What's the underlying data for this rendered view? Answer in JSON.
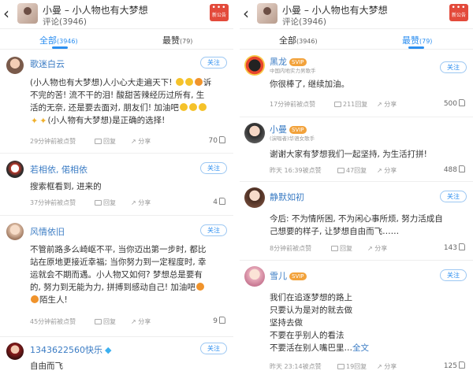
{
  "left": {
    "header": {
      "title": "小曼 – 小人物也有大梦想",
      "subtitle": "评论(3946)",
      "badge_label": "新公告"
    },
    "tabs": [
      {
        "label": "全部",
        "count": "(3946)",
        "active": true
      },
      {
        "label": "最赞",
        "count": "(79)",
        "active": false
      }
    ],
    "comments": [
      {
        "name": "歌迷白云",
        "follow": "关注",
        "lines": [
          "(小人物也有大梦想)人小心大走遍天下! ",
          "不完的苦! 流不干的泪! 酸甜苦辣经历过所有, 生",
          "活的无奈, 还是要去面对, 朋友们! 加油吧",
          "(小人物有大梦想)是正确的选择!"
        ],
        "line0_tail": "诉",
        "time": "29分钟前被点赞",
        "reply": "回复",
        "share": "分享",
        "likes": "70"
      },
      {
        "name": "若相依, 偌相依",
        "follow": "关注",
        "lines": [
          "搜索框看到, 进来的"
        ],
        "time": "37分钟前被点赞",
        "reply": "回复",
        "share": "分享",
        "likes": "4"
      },
      {
        "name": "风情依旧",
        "follow": "关注",
        "lines": [
          "不管前路多么崎岖不平, 当你迈出第一步时, 都比",
          "站在原地更接近幸福; 当你努力到一定程度时, 幸",
          "运就会不期而遇。小人物又如何? 梦想总是要有",
          "的, 努力到无能为力, 拼搏到感动自己! 加油吧",
          "陌生人!"
        ],
        "time": "45分钟前被点赞",
        "reply": "回复",
        "share": "分享",
        "likes": "9"
      },
      {
        "name": "1343622560快乐",
        "follow": "关注",
        "lines": [
          "自由而飞"
        ]
      }
    ]
  },
  "right": {
    "header": {
      "title": "小曼 – 小人物也有大梦想",
      "subtitle": "评论(3946)",
      "badge_label": "新公告"
    },
    "tabs": [
      {
        "label": "全部",
        "count": "(3946)",
        "active": false
      },
      {
        "label": "最赞",
        "count": "(79)",
        "active": true
      }
    ],
    "comments": [
      {
        "name": "黑龙",
        "svip": "SVIP",
        "verify": "中国内地实力男歌手",
        "follow": "关注",
        "lines": [
          "你很棒了, 继续加油。"
        ],
        "time": "17分钟前被点赞",
        "reply": "211回复",
        "share": "分享",
        "likes": "500"
      },
      {
        "name": "小曼",
        "svip": "SVIP",
        "verify": "(演唱者)华语女歌手",
        "lines": [
          "谢谢大家有梦想我们一起坚持, 为生活打拼!"
        ],
        "time": "昨天 16:39被点赞",
        "reply": "47回复",
        "share": "分享",
        "likes": "488"
      },
      {
        "name": "静默如初",
        "follow": "关注",
        "lines": [
          "今后: 不为情所困, 不为闲心事所烦, 努力活成自",
          "己想要的样子, 让梦想自由而飞……"
        ],
        "time": "8分钟前被点赞",
        "reply": "回复",
        "share": "分享",
        "likes": "143"
      },
      {
        "name": "雪儿",
        "svip": "SVIP",
        "follow": "关注",
        "lines": [
          "我们在追逐梦想的路上",
          "只要认为是对的就去做",
          "坚持去做",
          "不要在乎别人的看法",
          "不要活在别人嘴巴里…"
        ],
        "more": "全文",
        "time": "昨天 23:14被点赞",
        "reply": "19回复",
        "share": "分享",
        "likes": "125"
      }
    ]
  },
  "colors": {
    "accent": "#2b8ef0",
    "name": "#3b7cc4",
    "svip": "#f2a23b",
    "badge": "#e34a3b"
  }
}
